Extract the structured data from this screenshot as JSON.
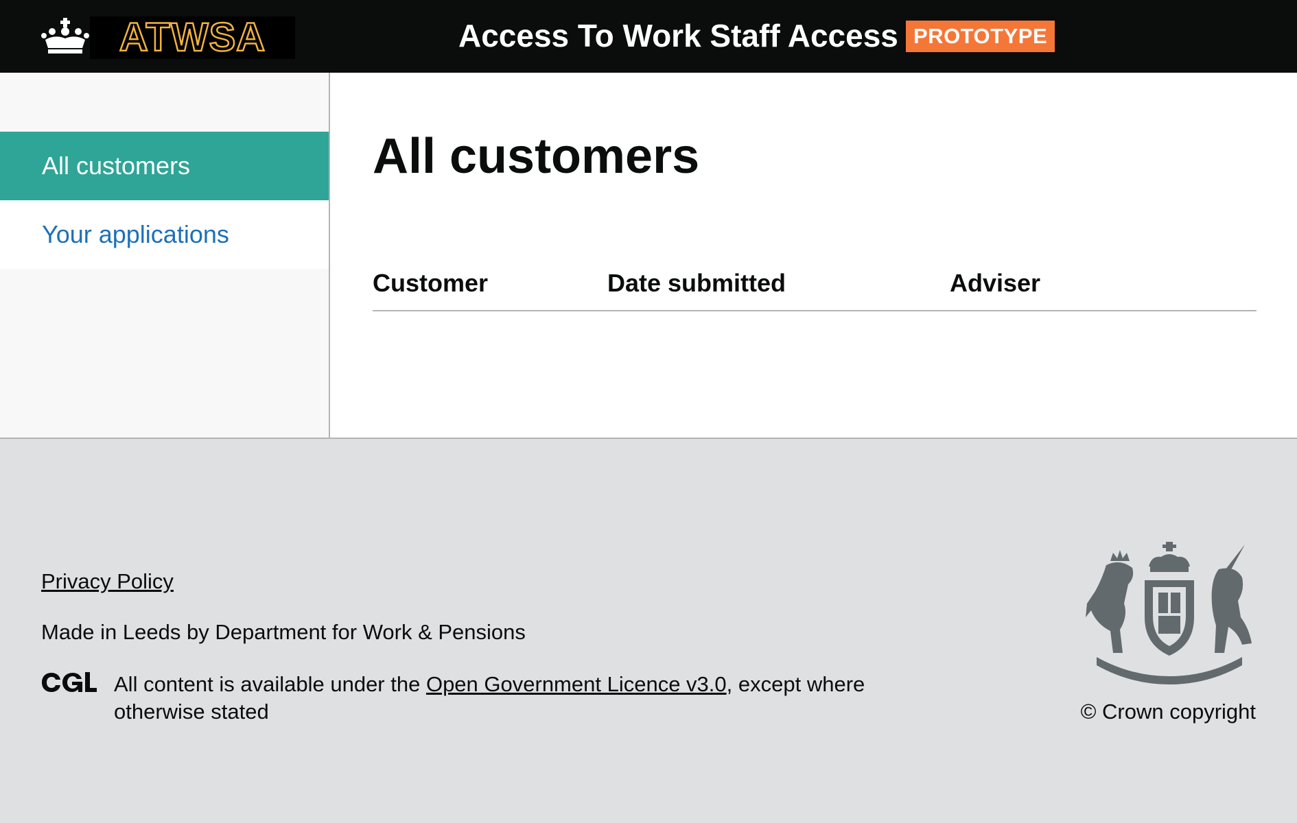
{
  "header": {
    "logo_text": "ATWSA",
    "service_name": "Access To Work Staff Access",
    "phase_tag": "PROTOTYPE"
  },
  "sidebar": {
    "items": [
      {
        "label": "All customers",
        "active": true
      },
      {
        "label": "Your applications",
        "active": false
      }
    ]
  },
  "main": {
    "title": "All customers",
    "table": {
      "columns": [
        "Customer",
        "Date submitted",
        "Adviser"
      ],
      "rows": []
    }
  },
  "footer": {
    "privacy_link": "Privacy Policy",
    "made_in": "Made in Leeds by Department for Work & Pensions",
    "licence_prefix": "All content is available under the ",
    "licence_link": "Open Government Licence v3.0",
    "licence_suffix": ", except where otherwise stated",
    "copyright": "© Crown copyright"
  },
  "colors": {
    "header_bg": "#0b0c0c",
    "logo_outline": "#f3b33e",
    "phase_tag_bg": "#f47738",
    "active_nav_bg": "#2ea596",
    "link": "#1d70b8",
    "footer_bg": "#dee0e2"
  }
}
